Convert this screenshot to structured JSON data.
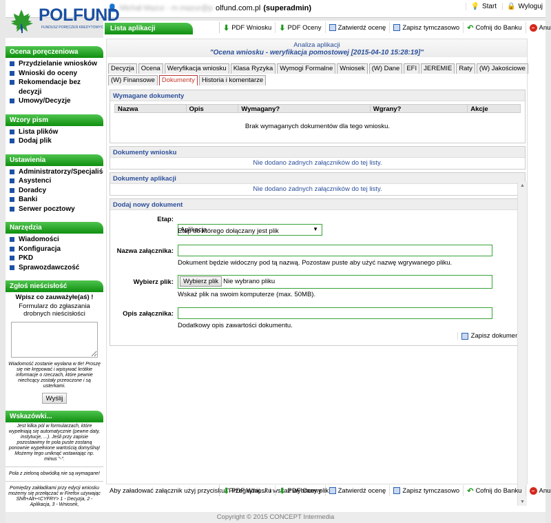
{
  "header": {
    "logo_text": "POLFUND",
    "logo_sub": "FUNDUSZ PORĘCZEŃ KREDYTOWYCH",
    "user_email_blurred": "Michał Mazur - m.mazur@p",
    "user_email_visible": "olfund.com.pl",
    "user_role": "(superadmin)",
    "start_label": "Start",
    "logout_label": "Wyloguj"
  },
  "page_title": "Lista aplikacji",
  "toolbar": {
    "pdf_wniosku": "PDF Wniosku",
    "pdf_oceny": "PDF Oceny",
    "zatwierdz": "Zatwierdź ocenę",
    "zapisz_tymczasowo": "Zapisz tymczasowo",
    "cofnij": "Cofnij do Banku",
    "anuluj": "Anuluj"
  },
  "content_head": {
    "title": "Analiza aplikacji",
    "subtitle": "\"Ocena wniosku - weryfikacja pomostowej [2015-04-10 15:28:19]\""
  },
  "tabs_row1": [
    "Decyzja",
    "Ocena",
    "Weryfikacja wniosku",
    "Klasa Ryzyka",
    "Wymogi Formalne",
    "Wniosek",
    "(W) Dane",
    "EFI",
    "JEREMIE",
    "Raty",
    "(W) Jakościowe"
  ],
  "tabs_row2": [
    "(W) Finansowe",
    "Dokumenty",
    "Historia i komentarze"
  ],
  "required_docs": {
    "title": "Wymagane dokumenty",
    "columns": [
      "Nazwa",
      "Opis",
      "Wymagany?",
      "Wgrany?",
      "Akcje"
    ],
    "empty": "Brak wymaganych dokumentów dla tego wniosku."
  },
  "app_docs": {
    "title": "Dokumenty wniosku",
    "empty": "Nie dodano żadnych załączników do tej listy."
  },
  "application_docs": {
    "title": "Dokumenty aplikacji",
    "empty": "Nie dodano żadnych załączników do tej listy."
  },
  "add_doc": {
    "title": "Dodaj nowy dokument",
    "etap_label": "Etap:",
    "etap_value": "Aplikacja",
    "etap_hint": "Etap do którego dołączany jest plik",
    "name_label": "Nazwa załącznika:",
    "name_hint": "Dokument będzie widoczny pod tą nazwą. Pozostaw puste aby użyć nazwę wgrywanego pliku.",
    "file_label": "Wybierz plik:",
    "file_button": "Wybierz plik",
    "file_none": "Nie wybrano pliku",
    "file_hint": "Wskaż plik na swoim komputerze (max. 50MB).",
    "desc_label": "Opis załącznika:",
    "desc_hint": "Dodatkowy opis zawartości dokumentu.",
    "save_label": "Zapisz dokument"
  },
  "footer_note": "Aby załadować załącznik użyj przycisku \"Przeglądaj...\" i wskaż wybrany plik.",
  "copyright": "Copyright © 2015 CONCEPT Intermedia",
  "sidebar": {
    "sec1": {
      "title": "Ocena poręczeniowa",
      "items": [
        "Przydzielanie wniosków",
        "Wnioski do oceny",
        "Rekomendacje bez decyzji",
        "Umowy/Decyzje"
      ]
    },
    "sec2": {
      "title": "Wzory pism",
      "items": [
        "Lista plików",
        "Dodaj plik"
      ]
    },
    "sec3": {
      "title": "Ustawienia",
      "items": [
        "Administratorzy/Specjaliści",
        "Asystenci",
        "Doradcy",
        "Banki",
        "Serwer pocztowy"
      ]
    },
    "sec4": {
      "title": "Narzędzia",
      "items": [
        "Wiadomości",
        "Konfiguracja",
        "PKD",
        "Sprawozdawczość"
      ]
    },
    "sec5": {
      "title": "Zgłoś nieścisłość",
      "line1": "Wpisz co zauważyłe(aś) !",
      "line2": "Formularz do zgłaszania drobnych nieścisłości",
      "note": "Wiadomość zostanie wysłana w tle! Proszę się nie krępować i wpisywać krótkie informacje o rzeczach, które pewnie niechcący zostały przeoczone i są usterkami.",
      "button": "Wyślij"
    },
    "sec6": {
      "title": "Wskazówki...",
      "tip1": "Jest kilka pól w formularzach, które wypełniają się automatycznie (pewne daty, instytucje, ...). Jeśli przy zapisie pozostawimy te pola puste zostaną ponownie wypełnione wartością domyślną! Możemy tego uniknąć wstawiając np. minus \"-\".",
      "tip2": "Pola z zieloną obwódką nie są wymagane!",
      "tip3": "Pomiędzy zakładkami przy edycji wniosku możemy się przełączać w Firefox używając Shift+Alt+<CYFRY> 1 - Decyzja, 2 - Aplikacja, 3 - Wniosek,"
    }
  }
}
